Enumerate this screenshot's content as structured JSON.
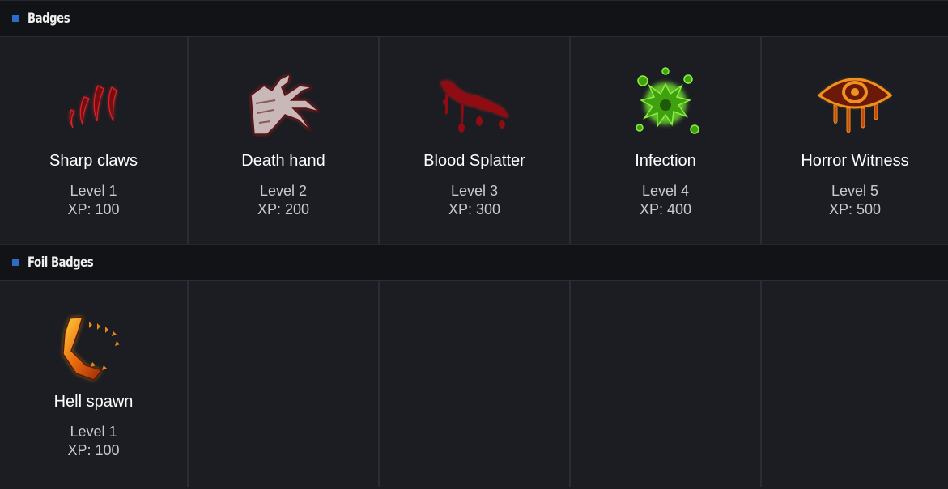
{
  "badges_section": {
    "title": "Badges",
    "items": [
      {
        "name": "Sharp claws",
        "level": "Level 1",
        "xp": "XP: 100",
        "icon": "claw-marks-icon"
      },
      {
        "name": "Death hand",
        "level": "Level 2",
        "xp": "XP: 200",
        "icon": "skeletal-hand-icon"
      },
      {
        "name": "Blood Splatter",
        "level": "Level 3",
        "xp": "XP: 300",
        "icon": "blood-splatter-icon"
      },
      {
        "name": "Infection",
        "level": "Level 4",
        "xp": "XP: 400",
        "icon": "green-splat-icon"
      },
      {
        "name": "Horror Witness",
        "level": "Level 5",
        "xp": "XP: 500",
        "icon": "bleeding-eye-icon"
      }
    ]
  },
  "foil_section": {
    "title": "Foil Badges",
    "items": [
      {
        "name": "Hell spawn",
        "level": "Level 1",
        "xp": "XP: 100",
        "icon": "fiery-jaw-icon"
      }
    ]
  },
  "colors": {
    "accent": "#2a6cc8",
    "background": "#1b1d22",
    "header_background": "#111317",
    "blood_red": "#b0121a",
    "infection_green": "#5fd21e",
    "fire_orange": "#e06a10"
  }
}
